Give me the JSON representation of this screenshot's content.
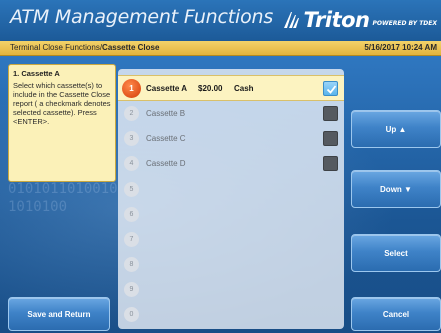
{
  "header": {
    "title": "ATM Management Functions",
    "brand_name": "Triton",
    "brand_sub": "POWERED BY TDEX"
  },
  "breadcrumb": {
    "parent": "Terminal Close Functions/",
    "current": "Cassette Close",
    "datetime": "5/16/2017  10:24 AM"
  },
  "help": {
    "title": "1. Cassette A",
    "body": "Select which cassette(s) to include in the Cassette Close report ( a checkmark denotes selected cassette). Press <ENTER>."
  },
  "cassettes": [
    {
      "num": "1",
      "name": "Cassette A",
      "amount": "$20.00",
      "type": "Cash",
      "checked": true
    },
    {
      "num": "2",
      "name": "Cassette B",
      "amount": "",
      "type": "",
      "checked": false
    },
    {
      "num": "3",
      "name": "Cassette C",
      "amount": "",
      "type": "",
      "checked": false
    },
    {
      "num": "4",
      "name": "Cassette D",
      "amount": "",
      "type": "",
      "checked": false
    },
    {
      "num": "5",
      "name": "",
      "amount": "",
      "type": "",
      "checked": null
    },
    {
      "num": "6",
      "name": "",
      "amount": "",
      "type": "",
      "checked": null
    },
    {
      "num": "7",
      "name": "",
      "amount": "",
      "type": "",
      "checked": null
    },
    {
      "num": "8",
      "name": "",
      "amount": "",
      "type": "",
      "checked": null
    },
    {
      "num": "9",
      "name": "",
      "amount": "",
      "type": "",
      "checked": null
    },
    {
      "num": "0",
      "name": "",
      "amount": "",
      "type": "",
      "checked": null
    }
  ],
  "buttons": {
    "up": "Up ▲",
    "down": "Down ▼",
    "select": "Select",
    "save_return": "Save and Return",
    "cancel": "Cancel"
  },
  "decor_digits": "01010110100101010100",
  "colors": {
    "header": "#2b74b9",
    "crumb_bar": "#e3b43d",
    "help_box": "#fbf1b8",
    "selected_row": "#fcf3c1",
    "selected_badge": "#e0521c",
    "button": "#3f83c8"
  }
}
